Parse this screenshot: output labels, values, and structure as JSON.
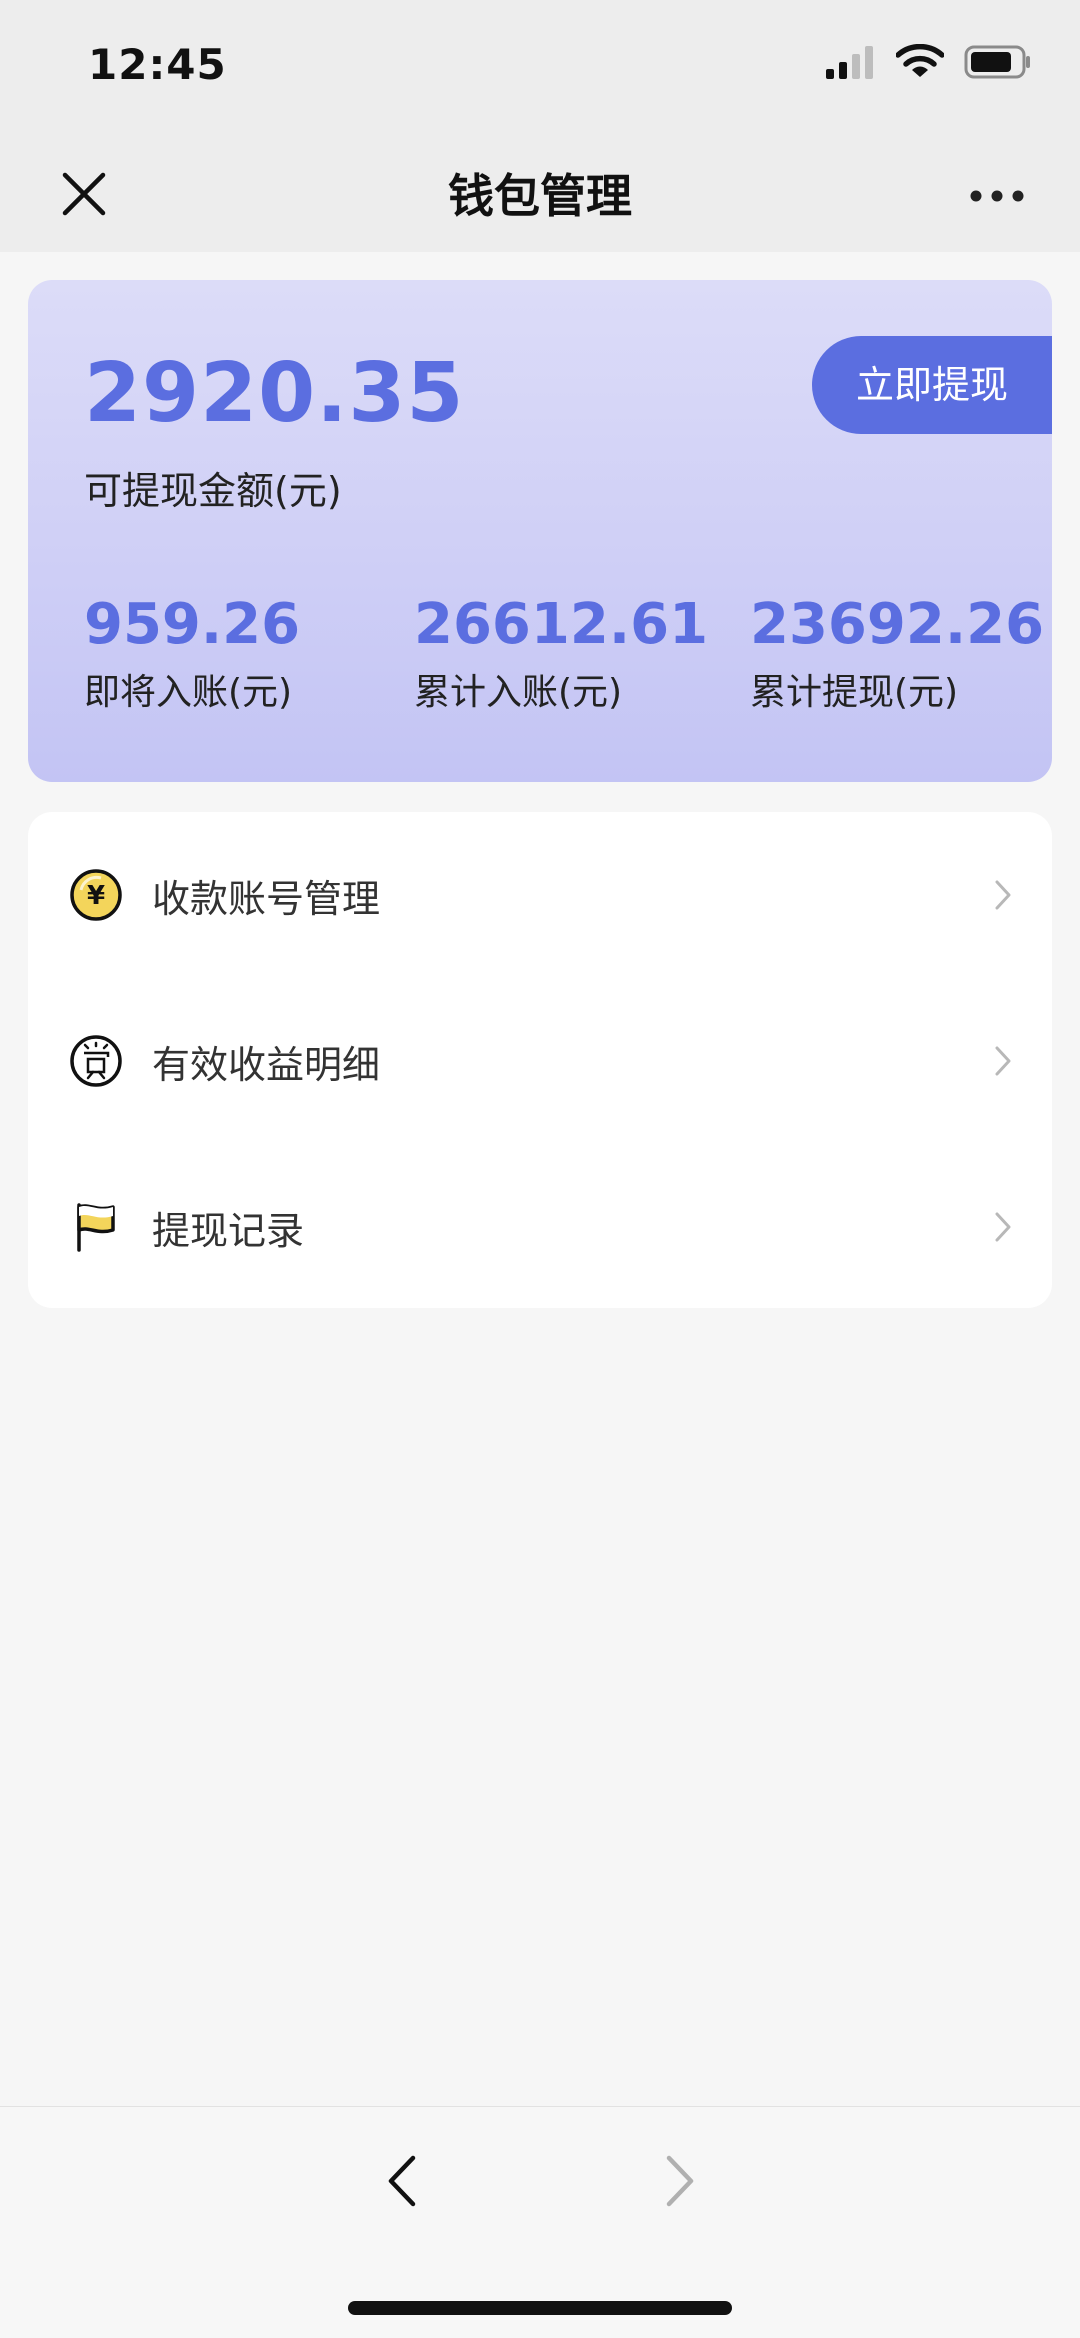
{
  "status_bar": {
    "time": "12:45",
    "icons": [
      "cellular-signal-icon",
      "wifi-icon",
      "battery-icon"
    ]
  },
  "nav_bar": {
    "title": "钱包管理",
    "close_icon": "close-icon",
    "more_icon": "more-icon"
  },
  "wallet": {
    "balance": "2920.35",
    "balance_label": "可提现金额(元)",
    "withdraw_button": "立即提现",
    "stats": [
      {
        "value": "959.26",
        "label": "即将入账(元)"
      },
      {
        "value": "26612.61",
        "label": "累计入账(元)"
      },
      {
        "value": "23692.26",
        "label": "累计提现(元)"
      }
    ]
  },
  "menu": {
    "items": [
      {
        "label": "收款账号管理",
        "icon": "yuan-coin-icon"
      },
      {
        "label": "有效收益明细",
        "icon": "reward-icon"
      },
      {
        "label": "提现记录",
        "icon": "flag-icon"
      }
    ]
  },
  "bottom_bar": {
    "icons": [
      "back-arrow-icon",
      "forward-arrow-icon"
    ]
  },
  "colors": {
    "accent": "#5b6ee0",
    "card_gradient_top": "#dcdcf8",
    "card_gradient_bottom": "#c3c4f4",
    "page_background": "#f6f6f6",
    "bar_background": "#ededed",
    "coin_yellow": "#f3d55b"
  }
}
